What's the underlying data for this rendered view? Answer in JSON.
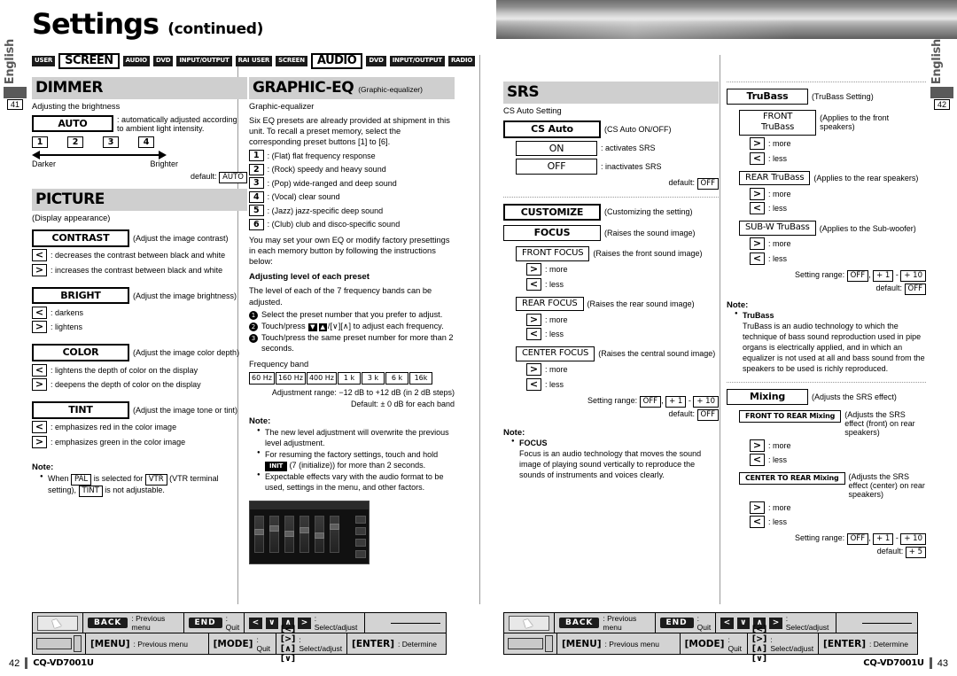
{
  "header": {
    "title": "Settings",
    "continued": "(continued)"
  },
  "side": {
    "left": {
      "language": "English",
      "page": "41"
    },
    "right": {
      "language": "English",
      "page": "42"
    }
  },
  "tabs_screen": [
    {
      "label": "USER",
      "active": false
    },
    {
      "label": "SCREEN",
      "active": true
    },
    {
      "label": "AUDIO",
      "active": false
    },
    {
      "label": "DVD",
      "active": false
    },
    {
      "label": "INPUT/OUTPUT",
      "active": false
    },
    {
      "label": "RADIO",
      "active": false
    }
  ],
  "tabs_audio": [
    {
      "label": "USER",
      "active": false
    },
    {
      "label": "SCREEN",
      "active": false
    },
    {
      "label": "AUDIO",
      "active": true
    },
    {
      "label": "DVD",
      "active": false
    },
    {
      "label": "INPUT/OUTPUT",
      "active": false
    },
    {
      "label": "RADIO",
      "active": false
    }
  ],
  "dimmer": {
    "heading": "DIMMER",
    "subtitle": "Adjusting the brightness",
    "auto_label": "AUTO",
    "auto_desc": ": automatically adjusted according to ambient light intensity.",
    "levels": [
      "1",
      "2",
      "3",
      "4"
    ],
    "scale_left": "Darker",
    "scale_right": "Brighter",
    "default_label": "default:",
    "default_value": "AUTO"
  },
  "picture": {
    "heading": "PICTURE",
    "subtitle": "(Display appearance)",
    "items": [
      {
        "name": "CONTRAST",
        "desc": "(Adjust the image contrast)",
        "left_desc": ": decreases the contrast between black and white",
        "right_desc": ": increases the contrast between black and white"
      },
      {
        "name": "BRIGHT",
        "desc": "(Adjust the image brightness)",
        "left_desc": ": darkens",
        "right_desc": ": lightens"
      },
      {
        "name": "COLOR",
        "desc": "(Adjust the image color depth)",
        "left_desc": ": lightens the depth of color on the display",
        "right_desc": ": deepens the depth of color on the display"
      },
      {
        "name": "TINT",
        "desc": "(Adjust the image tone or tint)",
        "left_desc": ": emphasizes red in the color image",
        "right_desc": ": emphasizes green in the color image"
      }
    ],
    "note_title": "Note:",
    "note_pre": "When",
    "note_pal": "PAL",
    "note_mid": "is selected for",
    "note_vtr": "VTR",
    "note_mid2": "(VTR terminal setting),",
    "note_tint": "TINT",
    "note_end": "is not adjustable."
  },
  "graphic_eq": {
    "heading": "GRAPHIC-EQ",
    "heading_sub": "(Graphic-equalizer)",
    "subtitle": "Graphic-equalizer",
    "intro": "Six EQ presets are already provided at shipment in this unit. To recall a preset memory, select the corresponding preset buttons [1] to [6].",
    "presets": [
      {
        "num": "1",
        "desc": ": (Flat) flat frequency response"
      },
      {
        "num": "2",
        "desc": ": (Rock) speedy and heavy sound"
      },
      {
        "num": "3",
        "desc": ": (Pop) wide-ranged and deep sound"
      },
      {
        "num": "4",
        "desc": ": (Vocal) clear sound"
      },
      {
        "num": "5",
        "desc": ": (Jazz) jazz-specific deep sound"
      },
      {
        "num": "6",
        "desc": ": (Club) club and disco-specific sound"
      }
    ],
    "custom_intro": "You may set your own EQ or modify factory presettings in each memory button by following the instructions below:",
    "adjust_title": "Adjusting level of each preset",
    "adjust_intro": "The level of each of the 7 frequency bands can be adjusted.",
    "steps": [
      "Select the preset number that you prefer to adjust.",
      "Touch/press      /[\\/][/\\] to adjust each frequency.",
      "Touch/press the same preset number for more than 2 seconds."
    ],
    "step2_pre": "Touch/press",
    "step2_post": "/[∨][∧] to adjust each frequency.",
    "freq_label": "Frequency band",
    "freq_bands": [
      "60 Hz",
      "160 Hz",
      "400 Hz",
      "1 k",
      "3 k",
      "6 k",
      "16k"
    ],
    "range_line": "Adjustment range: −12 dB to +12 dB (in 2 dB steps)",
    "default_line": "Default: ± 0 dB for each band",
    "note_title": "Note:",
    "notes": [
      "The new level adjustment will overwrite the previous level adjustment.",
      "For resuming the factory settings, touch and hold",
      "Expectable effects vary with the audio format to be used, settings in the menu, and other factors."
    ],
    "note2_btn": "INIT",
    "note2_tail": "(7 (initialize)) for more than 2 seconds."
  },
  "srs": {
    "heading": "SRS",
    "subtitle": "CS Auto Setting",
    "cs_auto": {
      "label": "CS Auto",
      "desc": "(CS Auto ON/OFF)"
    },
    "on": {
      "label": "ON",
      "desc": ": activates SRS"
    },
    "off": {
      "label": "OFF",
      "desc": ": inactivates SRS"
    },
    "default_label": "default:",
    "default_value": "OFF"
  },
  "customize": {
    "heading": "CUSTOMIZE",
    "heading_desc": "(Customizing the setting)",
    "focus": {
      "label": "FOCUS",
      "desc": "(Raises the sound image)"
    },
    "focus_items": [
      {
        "label": "FRONT FOCUS",
        "desc": "(Raises the front sound image)"
      },
      {
        "label": "REAR FOCUS",
        "desc": "(Raises the rear sound image)"
      },
      {
        "label": "CENTER FOCUS",
        "desc": "(Raises the central sound image)"
      }
    ],
    "more": ": more",
    "less": ": less",
    "range_label": "Setting range:",
    "range_off": "OFF",
    "range_comma": ",",
    "range_p1": "+ 1",
    "range_dash": "-",
    "range_p10": "+ 10",
    "default_label": "default:",
    "default_value": "OFF",
    "note_title": "Note:",
    "note_term": "FOCUS",
    "note_body": "Focus is an audio technology that moves the sound image of playing sound vertically to reproduce the sounds of instruments and voices clearly."
  },
  "trubass": {
    "label": "TruBass",
    "desc": "(TruBass Setting)",
    "items": [
      {
        "label": "FRONT TruBass",
        "desc": "(Applies  to the front speakers)"
      },
      {
        "label": "REAR TruBass",
        "desc": "(Applies to the rear speakers)"
      },
      {
        "label": "SUB-W TruBass",
        "desc": "(Applies to the Sub-woofer)"
      }
    ],
    "more": ": more",
    "less": ": less",
    "range_label": "Setting range:",
    "range_off": "OFF",
    "range_p1": "+ 1",
    "range_dash": "-",
    "range_p10": "+ 10",
    "default_label": "default:",
    "default_value": "OFF",
    "note_title": "Note:",
    "note_term": "TruBass",
    "note_body": "TruBass is an audio technology to which the technique of bass sound reproduction used in pipe organs is electrically applied, and in which an equalizer is not used at all and bass sound from the speakers to be used is richly reproduced."
  },
  "mixing": {
    "label": "Mixing",
    "desc": "(Adjusts the SRS effect)",
    "items": [
      {
        "label": "FRONT TO REAR Mixing",
        "desc": "(Adjusts the SRS effect (front) on rear speakers)"
      },
      {
        "label": "CENTER TO REAR Mixing",
        "desc": "(Adjusts the SRS effect (center) on rear speakers)"
      }
    ],
    "more": ": more",
    "less": ": less",
    "range_label": "Setting range:",
    "range_off": "OFF",
    "range_p1": "+ 1",
    "range_dash": "-",
    "range_p10": "+ 10",
    "default_label": "default:",
    "default_value": "+ 5"
  },
  "footer": {
    "back_btn": "BACK",
    "back_desc": ": Previous menu",
    "end_btn": "END",
    "end_desc": ": Quit",
    "arrows_top": [
      "<",
      "∨",
      "∧",
      ">"
    ],
    "select_desc": ": Select/adjust",
    "menu_key": "[MENU]",
    "menu_desc": ": Previous menu",
    "mode_key": "[MODE]",
    "mode_desc": ": Quit",
    "arrows_bottom": "[<] [>] [∧] [∨]",
    "select_desc2": ": Select/adjust",
    "enter_key": "[ENTER]",
    "enter_desc": ": Determine"
  },
  "pages": {
    "left_num": "42",
    "left_model": "CQ-VD7001U",
    "right_model": "CQ-VD7001U",
    "right_num": "43"
  }
}
